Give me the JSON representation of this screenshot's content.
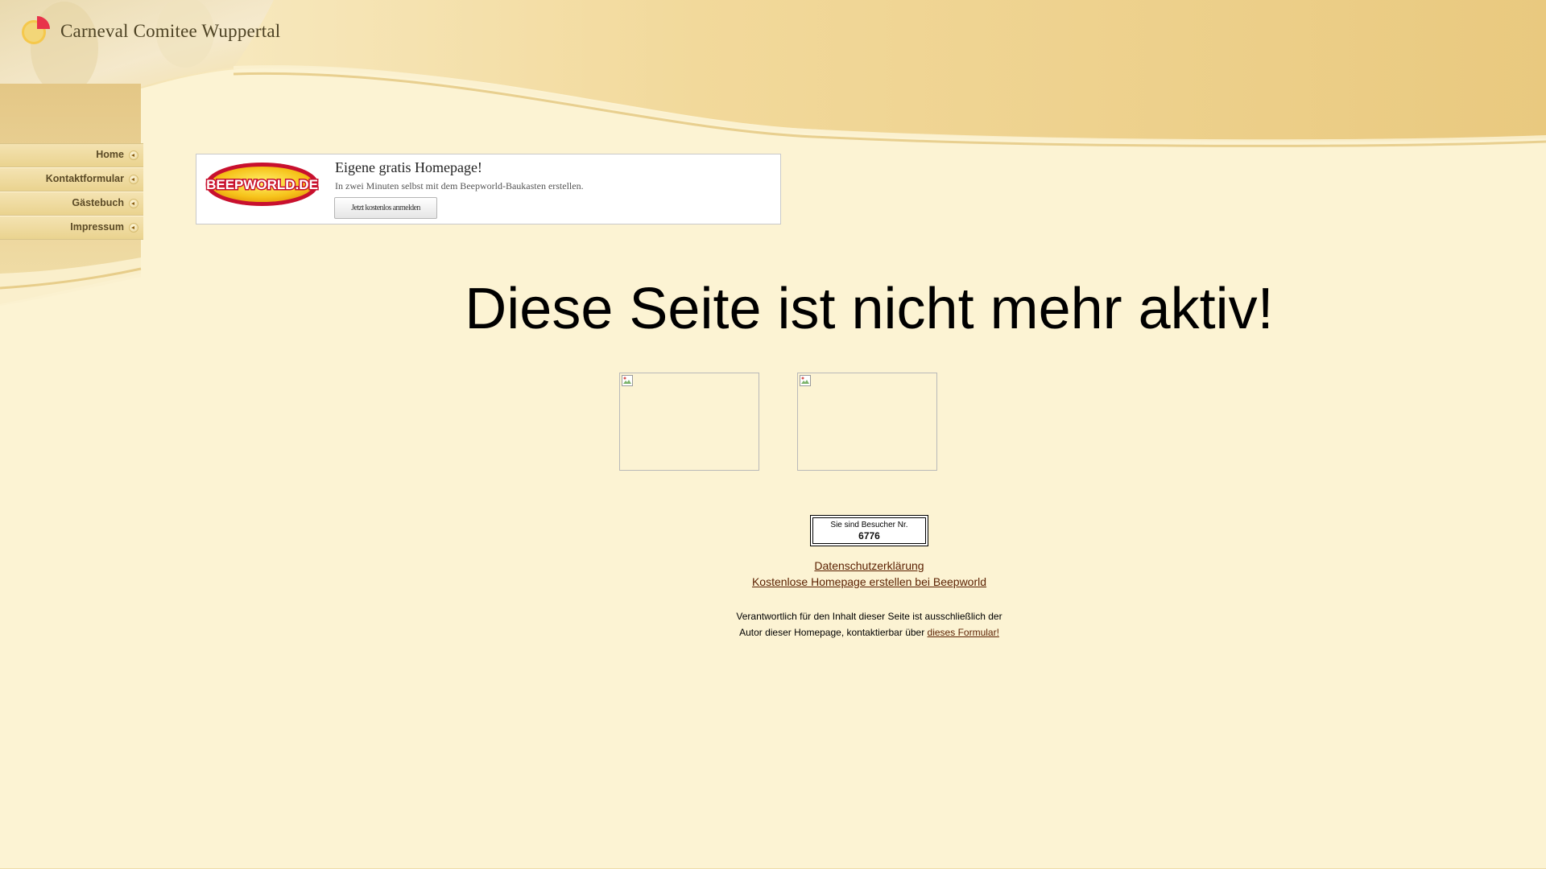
{
  "site": {
    "title": "Carneval Comitee Wuppertal",
    "logo_icon": "pie-logo-icon"
  },
  "nav": {
    "items": [
      {
        "label": "Home"
      },
      {
        "label": "Kontaktformular"
      },
      {
        "label": "Gästebuch"
      },
      {
        "label": "Impressum"
      }
    ],
    "arrow_icon": "left-arrow-bullet-icon"
  },
  "ad": {
    "logo_text": "BEEPWORLD.DE",
    "headline": "Eigene gratis Homepage!",
    "text": "In zwei Minuten selbst mit dem Beepworld-Baukasten erstellen.",
    "button_label": "Jetzt kostenlos anmelden"
  },
  "main": {
    "message": "Diese Seite ist nicht mehr aktiv!"
  },
  "counter": {
    "label": "Sie sind Besucher Nr.",
    "value": "6776"
  },
  "footer": {
    "privacy_link": "Datenschutzerklärung",
    "homepage_link": "Kostenlose Homepage erstellen bei Beepworld",
    "responsibility_line1": "Verantwortlich für den Inhalt dieser Seite ist ausschließlich der",
    "responsibility_line2": "Autor dieser Homepage, kontaktierbar über",
    "contact_link": "dieses Formular!"
  },
  "colors": {
    "background": "#fcf3d3",
    "header_gold": "#ecd08c",
    "link_color": "#5a1f00",
    "title_color": "#4e4324"
  }
}
